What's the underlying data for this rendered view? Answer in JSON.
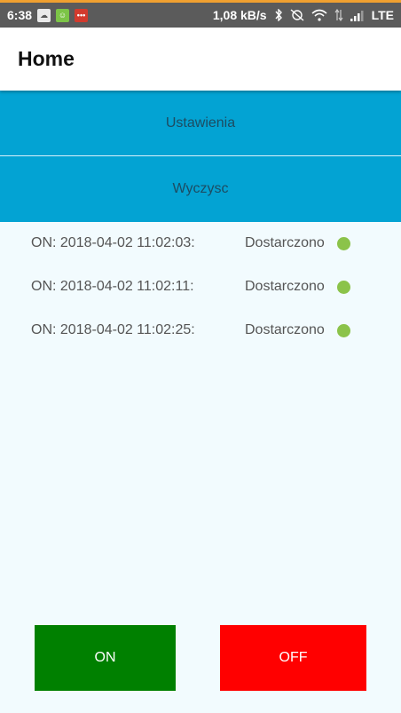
{
  "status_bar": {
    "time": "6:38",
    "speed": "1,08 kB/s",
    "network": "LTE",
    "notification_icons": [
      "cloud-notification-icon",
      "android-notification-icon",
      "message-notification-icon"
    ],
    "system_icons": [
      "bluetooth-icon",
      "alarm-off-icon",
      "wifi-icon",
      "data-transfer-icon",
      "signal-icon"
    ]
  },
  "app_bar": {
    "title": "Home"
  },
  "menu": {
    "settings_label": "Ustawienia",
    "clear_label": "Wyczysc"
  },
  "log": [
    {
      "timestamp": "ON: 2018-04-02 11:02:03:",
      "status": "Dostarczono"
    },
    {
      "timestamp": "ON: 2018-04-02 11:02:11:",
      "status": "Dostarczono"
    },
    {
      "timestamp": "ON: 2018-04-02 11:02:25:",
      "status": "Dostarczono"
    }
  ],
  "actions": {
    "on_label": "ON",
    "off_label": "OFF"
  },
  "colors": {
    "menu_bg": "#03a3d3",
    "on_bg": "#008000",
    "off_bg": "#ff0000",
    "status_dot": "#8bc34a"
  }
}
